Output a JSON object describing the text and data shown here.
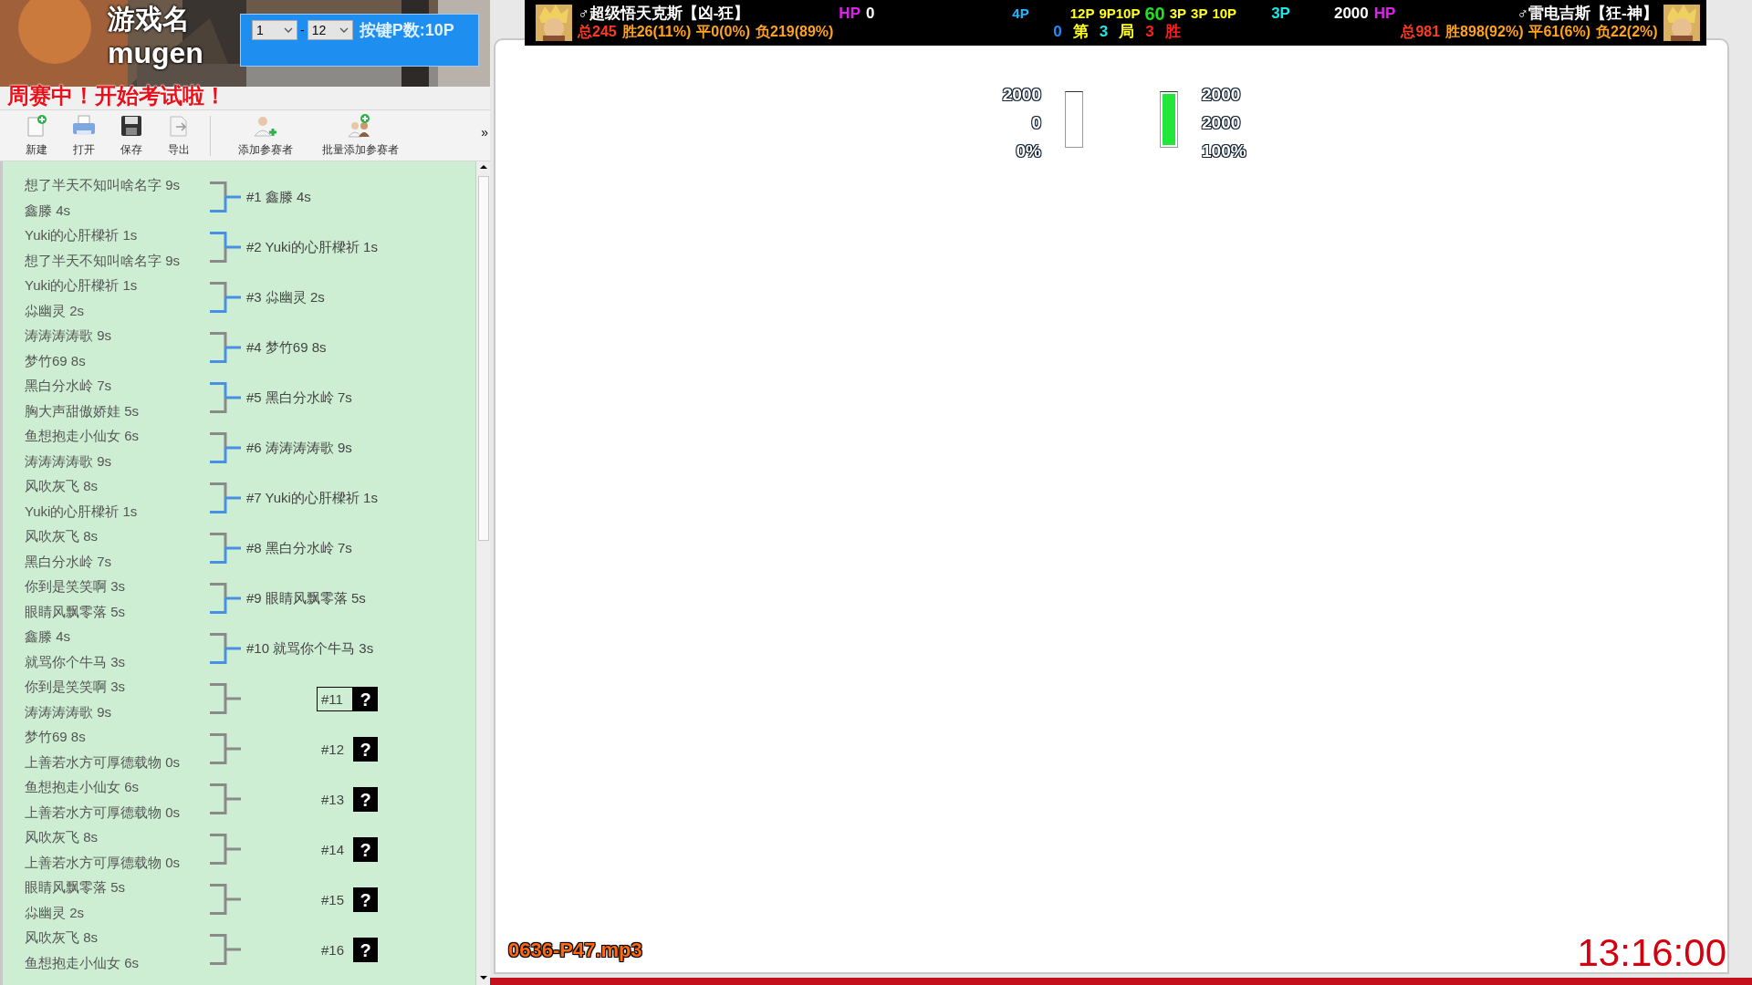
{
  "banner": {
    "game_title": "游戏名",
    "game_name": "mugen",
    "notice": "周赛中！开始考试啦！"
  },
  "range_box": {
    "from": "1",
    "separator": "-",
    "to": "12",
    "keys": "按键P数:10P"
  },
  "toolbar": [
    {
      "label": "新建",
      "kind": "new"
    },
    {
      "label": "打开",
      "kind": "open"
    },
    {
      "label": "保存",
      "kind": "save"
    },
    {
      "label": "导出",
      "kind": "export"
    },
    {
      "label": "添加参赛者",
      "kind": "add"
    },
    {
      "label": "批量添加参赛者",
      "kind": "batch"
    }
  ],
  "toolbar_more": "»",
  "matches": [
    {
      "kind": "decided",
      "players": [
        {
          "name": "想了半天不知叫啥名字 9s",
          "won": false
        },
        {
          "name": "鑫滕 4s",
          "won": true
        }
      ],
      "result": "#1 鑫滕 4s",
      "selected": false
    },
    {
      "kind": "decided",
      "players": [
        {
          "name": "Yuki的心肝樑祈 1s",
          "won": true
        },
        {
          "name": "想了半天不知叫啥名字 9s",
          "won": false
        }
      ],
      "result": "#2 Yuki的心肝樑祈 1s",
      "selected": false
    },
    {
      "kind": "decided",
      "players": [
        {
          "name": "Yuki的心肝樑祈 1s",
          "won": false
        },
        {
          "name": "尛幽灵 2s",
          "won": true
        }
      ],
      "result": "#3 尛幽灵 2s",
      "selected": false
    },
    {
      "kind": "decided",
      "players": [
        {
          "name": "涛涛涛涛歌 9s",
          "won": false
        },
        {
          "name": "梦竹69 8s",
          "won": true
        }
      ],
      "result": "#4 梦竹69 8s",
      "selected": false
    },
    {
      "kind": "decided",
      "players": [
        {
          "name": "黑白分水岭 7s",
          "won": true
        },
        {
          "name": "胸大声甜傲娇娃 5s",
          "won": false
        }
      ],
      "result": "#5 黑白分水岭 7s",
      "selected": false
    },
    {
      "kind": "decided",
      "players": [
        {
          "name": "鱼想抱走小仙女 6s",
          "won": false
        },
        {
          "name": "涛涛涛涛歌 9s",
          "won": true
        }
      ],
      "result": "#6 涛涛涛涛歌 9s",
      "selected": false
    },
    {
      "kind": "decided",
      "players": [
        {
          "name": "风吹灰飞 8s",
          "won": false
        },
        {
          "name": "Yuki的心肝樑祈 1s",
          "won": true
        }
      ],
      "result": "#7 Yuki的心肝樑祈 1s",
      "selected": false
    },
    {
      "kind": "decided",
      "players": [
        {
          "name": "风吹灰飞 8s",
          "won": false
        },
        {
          "name": "黑白分水岭 7s",
          "won": true
        }
      ],
      "result": "#8 黑白分水岭 7s",
      "selected": false
    },
    {
      "kind": "decided",
      "players": [
        {
          "name": "你到是笑笑啊 3s",
          "won": false
        },
        {
          "name": "眼睛风飘零落 5s",
          "won": true
        }
      ],
      "result": "#9 眼睛风飘零落 5s",
      "selected": false
    },
    {
      "kind": "decided",
      "players": [
        {
          "name": "鑫滕 4s",
          "won": false
        },
        {
          "name": "就骂你个牛马 3s",
          "won": true
        }
      ],
      "result": "#10 就骂你个牛马 3s",
      "selected": false
    },
    {
      "kind": "pending",
      "players": [
        {
          "name": "你到是笑笑啊 3s",
          "won": false
        },
        {
          "name": "涛涛涛涛歌 9s",
          "won": false
        }
      ],
      "number": "#11",
      "unknown": "?",
      "selected": true
    },
    {
      "kind": "pending",
      "players": [
        {
          "name": "梦竹69 8s",
          "won": false
        },
        {
          "name": "上善若水方可厚德载物 0s",
          "won": false
        }
      ],
      "number": "#12",
      "unknown": "?",
      "selected": false
    },
    {
      "kind": "pending",
      "players": [
        {
          "name": "鱼想抱走小仙女 6s",
          "won": false
        },
        {
          "name": "上善若水方可厚德载物 0s",
          "won": false
        }
      ],
      "number": "#13",
      "unknown": "?",
      "selected": false
    },
    {
      "kind": "pending",
      "players": [
        {
          "name": "风吹灰飞 8s",
          "won": false
        },
        {
          "name": "上善若水方可厚德载物 0s",
          "won": false
        }
      ],
      "number": "#14",
      "unknown": "?",
      "selected": false
    },
    {
      "kind": "pending",
      "players": [
        {
          "name": "眼睛风飘零落 5s",
          "won": false
        },
        {
          "name": "尛幽灵 2s",
          "won": false
        }
      ],
      "number": "#15",
      "unknown": "?",
      "selected": false
    },
    {
      "kind": "pending",
      "players": [
        {
          "name": "风吹灰飞 8s",
          "won": false
        },
        {
          "name": "鱼想抱走小仙女 6s",
          "won": false
        }
      ],
      "number": "#16",
      "unknown": "?",
      "selected": false
    }
  ],
  "hud": {
    "left_player": {
      "name": "♂超级悟天克斯【凶-狂】",
      "stats": [
        {
          "text": "总245",
          "color": "#ff3b1f"
        },
        {
          "text": "胜26(11%)",
          "color": "#ffa21f"
        },
        {
          "text": "平0(0%)",
          "color": "#ffa21f"
        },
        {
          "text": "负219(89%)",
          "color": "#ffa21f"
        }
      ]
    },
    "left_hp": {
      "label": "HP",
      "value": "0"
    },
    "center_tags": [
      {
        "text": "4P",
        "color": "#1fb8ff"
      },
      {
        "text": "12P",
        "color": "#ffff1f"
      },
      {
        "text": "9P10P",
        "color": "#ffff1f"
      },
      {
        "text": "60",
        "color": "#1fe01f"
      },
      {
        "text": "3P",
        "color": "#ffff1f"
      },
      {
        "text": "3P",
        "color": "#ffff1f"
      },
      {
        "text": "10P",
        "color": "#ffff1f"
      }
    ],
    "right_tag": {
      "text": "3P",
      "color": "#1fe8e8"
    },
    "round": [
      {
        "text": "0",
        "color": "#1f8cff"
      },
      {
        "text": "第",
        "color": "#ffff1f"
      },
      {
        "text": "3",
        "color": "#1fe8e8"
      },
      {
        "text": "局",
        "color": "#ffff1f"
      },
      {
        "text": "3",
        "color": "#ff1f1f"
      },
      {
        "text": "胜",
        "color": "#ff1f1f"
      }
    ],
    "right_hp": {
      "value": "2000",
      "label": "HP"
    },
    "right_player": {
      "name": "♂雷电吉斯【狂-神】",
      "stats": [
        {
          "text": "总981",
          "color": "#ff3b1f"
        },
        {
          "text": "胜898(92%)",
          "color": "#ffa21f"
        },
        {
          "text": "平61(6%)",
          "color": "#ffa21f"
        },
        {
          "text": "负22(2%)",
          "color": "#ffa21f"
        }
      ]
    }
  },
  "meters": [
    {
      "max": "2000",
      "value": "0",
      "percent": "0%",
      "level": 0
    },
    {
      "max": "2000",
      "value": "2000",
      "percent": "100%",
      "level": 1
    }
  ],
  "track": "0636-P47.mp3",
  "clock": "13:16:00"
}
